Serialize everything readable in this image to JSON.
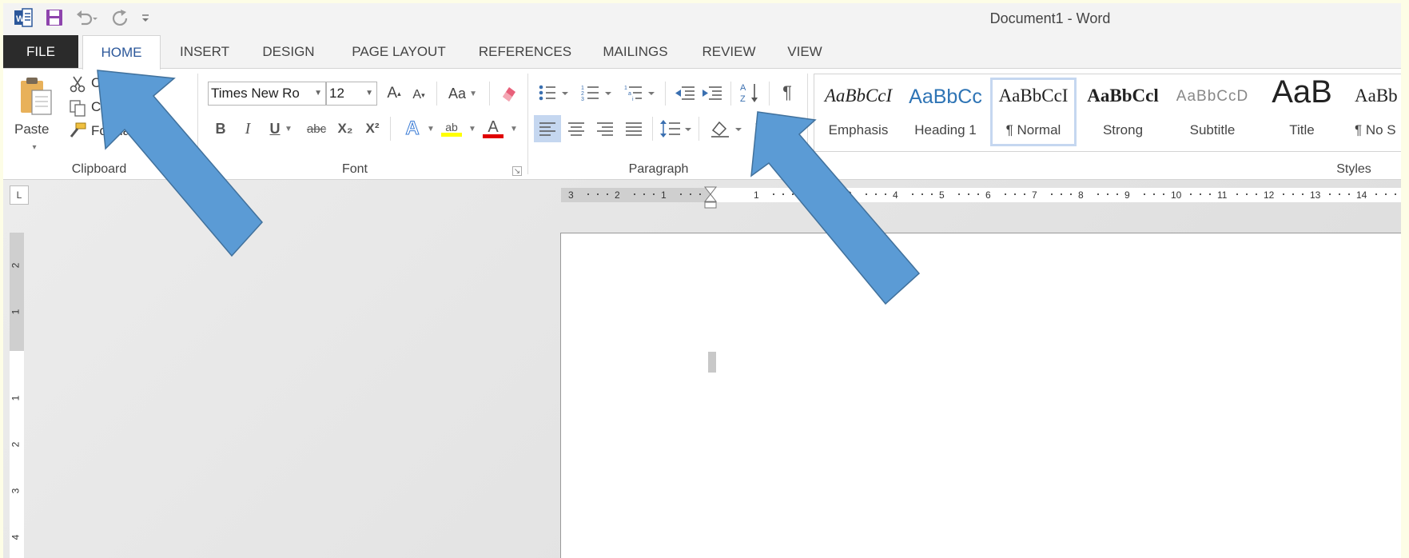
{
  "window": {
    "title": "Document1 - Word"
  },
  "quick_access": [
    {
      "icon": "word-logo-icon"
    },
    {
      "icon": "save-icon"
    },
    {
      "icon": "undo-icon"
    },
    {
      "icon": "redo-icon"
    },
    {
      "icon": "customize-qat-icon"
    }
  ],
  "tabs": [
    {
      "label": "FILE"
    },
    {
      "label": "HOME"
    },
    {
      "label": "INSERT"
    },
    {
      "label": "DESIGN"
    },
    {
      "label": "PAGE LAYOUT"
    },
    {
      "label": "REFERENCES"
    },
    {
      "label": "MAILINGS"
    },
    {
      "label": "REVIEW"
    },
    {
      "label": "VIEW"
    }
  ],
  "clipboard": {
    "group_label": "Clipboard",
    "paste_label": "Paste",
    "cut_label": "C",
    "copy_label": "Cop",
    "format_painter_label": "Forma"
  },
  "font": {
    "group_label": "Font",
    "font_name": "Times New Ro",
    "font_size": "12",
    "change_case_label": "Aa",
    "bold": "B",
    "italic": "I",
    "underline": "U",
    "strikethrough": "abc",
    "subscript": "X₂",
    "superscript": "X²",
    "text_effects": "A",
    "highlight": "ab",
    "font_color": "A",
    "highlight_color": "#ffff00",
    "font_color_value": "#e00000"
  },
  "paragraph": {
    "group_label": "Paragraph",
    "show_marks": "¶"
  },
  "styles": {
    "group_label": "Styles",
    "items": [
      {
        "sample": "AaBbCcI",
        "name": "Emphasis"
      },
      {
        "sample": "AaBbCc",
        "name": "Heading 1"
      },
      {
        "sample": "AaBbCcI",
        "name": "¶ Normal"
      },
      {
        "sample": "AaBbCcl",
        "name": "Strong"
      },
      {
        "sample": "AaBbCcD",
        "name": "Subtitle"
      },
      {
        "sample": "AaB",
        "name": "Title"
      },
      {
        "sample": "AaBb",
        "name": "¶ No S"
      }
    ]
  },
  "ruler": {
    "h_labels": [
      "3",
      "2",
      "1",
      "1",
      "2",
      "3",
      "4",
      "5",
      "6",
      "7",
      "8",
      "9",
      "10",
      "11",
      "12",
      "13",
      "14"
    ],
    "v_labels": [
      "2",
      "1",
      "1",
      "2",
      "3",
      "4"
    ],
    "tab_selector": "L"
  },
  "colors": {
    "accent": "#2b579a",
    "file_tab": "#2b2b2b",
    "arrow_fill": "#5b9bd5"
  }
}
